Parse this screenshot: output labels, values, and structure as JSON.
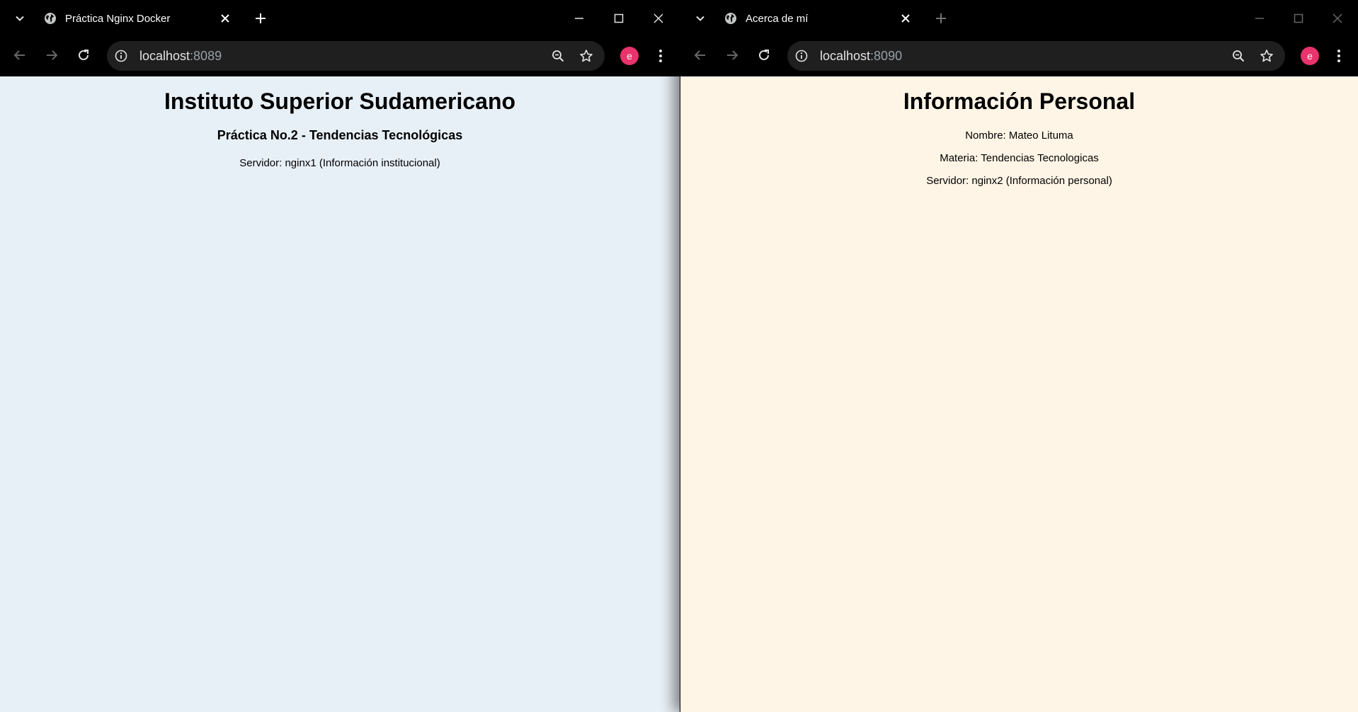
{
  "left_window": {
    "tab_title": "Práctica Nginx Docker",
    "url_host": "localhost",
    "url_port": ":8089",
    "profile_initial": "e",
    "page": {
      "heading": "Instituto Superior Sudamericano",
      "subheading": "Práctica No.2 - Tendencias Tecnológicas",
      "server_line": "Servidor: nginx1 (Información institucional)"
    }
  },
  "right_window": {
    "tab_title": "Acerca de mí",
    "url_host": "localhost",
    "url_port": ":8090",
    "profile_initial": "e",
    "page": {
      "heading": "Información Personal",
      "name_line": "Nombre: Mateo Lituma",
      "subject_line": "Materia: Tendencias Tecnologicas",
      "server_line": "Servidor: nginx2 (Información personal)"
    }
  },
  "icons": {
    "tab_search": "chevron-down-icon",
    "favicon": "globe-icon",
    "tab_close": "close-icon",
    "new_tab": "plus-icon",
    "minimize": "minimize-icon",
    "maximize": "maximize-icon",
    "close_window": "close-icon",
    "back": "arrow-left-icon",
    "forward": "arrow-right-icon",
    "reload": "reload-icon",
    "site_info": "info-icon",
    "zoom": "zoom-out-icon",
    "bookmark": "star-icon",
    "menu": "kebab-menu-icon"
  },
  "colors": {
    "left_page_bg": "#e8f0f7",
    "right_page_bg": "#fff5e6",
    "profile_avatar": "#e8336d",
    "chrome_frame": "#000000",
    "omnibox_bg": "#1f1f1f"
  }
}
